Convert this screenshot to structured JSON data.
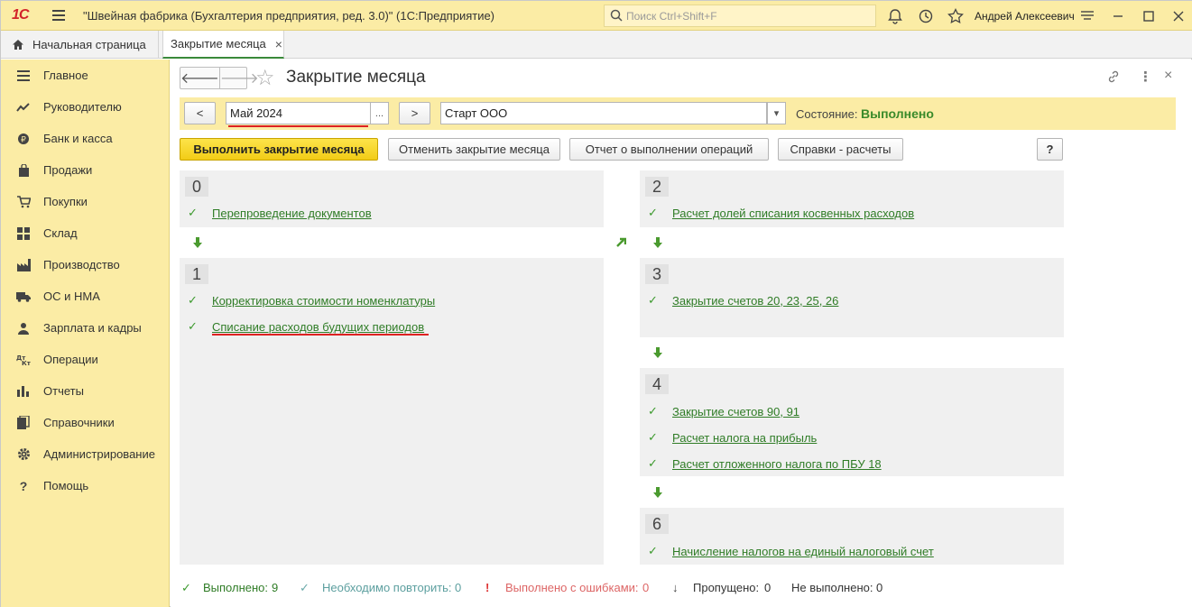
{
  "titlebar": {
    "logo": "1С",
    "title": "\"Швейная фабрика (Бухгалтерия предприятия, ред. 3.0)\"  (1С:Предприятие)",
    "search_placeholder": "Поиск Ctrl+Shift+F",
    "user": "Андрей Алексеевич"
  },
  "tabs": {
    "home": "Начальная страница",
    "active": "Закрытие месяца",
    "close": "×"
  },
  "sidebar": {
    "items": [
      {
        "label": "Главное",
        "icon": "menu-icon"
      },
      {
        "label": "Руководителю",
        "icon": "trend-icon"
      },
      {
        "label": "Банк и касса",
        "icon": "coin-icon"
      },
      {
        "label": "Продажи",
        "icon": "bag-icon"
      },
      {
        "label": "Покупки",
        "icon": "cart-icon"
      },
      {
        "label": "Склад",
        "icon": "warehouse-icon"
      },
      {
        "label": "Производство",
        "icon": "factory-icon"
      },
      {
        "label": "ОС и НМА",
        "icon": "truck-icon"
      },
      {
        "label": "Зарплата и кадры",
        "icon": "people-icon"
      },
      {
        "label": "Операции",
        "icon": "dt-kt-icon"
      },
      {
        "label": "Отчеты",
        "icon": "bar-chart-icon"
      },
      {
        "label": "Справочники",
        "icon": "books-icon"
      },
      {
        "label": "Администрирование",
        "icon": "gear-icon"
      },
      {
        "label": "Помощь",
        "icon": "help-icon"
      }
    ]
  },
  "form": {
    "title": "Закрытие месяца",
    "prev_btn": "<",
    "next_btn": ">",
    "period_value": "Май 2024",
    "period_select": "...",
    "org_value": "Старт ООО",
    "state_label": "Состояние:",
    "state_value": "Выполнено",
    "accent_color": "#3a8a2a"
  },
  "actions": {
    "run": "Выполнить закрытие месяца",
    "cancel": "Отменить закрытие месяца",
    "report": "Отчет о выполнении операций",
    "refs": "Справки - расчеты",
    "help": "?"
  },
  "stages": {
    "s0": {
      "num": "0",
      "ops": [
        "Перепроведение документов"
      ]
    },
    "s1": {
      "num": "1",
      "ops": [
        "Корректировка стоимости номенклатуры",
        "Списание расходов будущих периодов"
      ]
    },
    "s2": {
      "num": "2",
      "ops": [
        "Расчет долей списания косвенных расходов"
      ]
    },
    "s3": {
      "num": "3",
      "ops": [
        "Закрытие счетов 20, 23, 25, 26"
      ]
    },
    "s4": {
      "num": "4",
      "ops": [
        "Закрытие счетов 90, 91",
        "Расчет налога на прибыль",
        "Расчет отложенного налога по ПБУ 18"
      ]
    },
    "s6": {
      "num": "6",
      "ops": [
        "Начисление налогов на единый налоговый счет"
      ]
    }
  },
  "footer": {
    "done_label": "Выполнено:",
    "done_count": "9",
    "repeat_label": "Необходимо повторить:",
    "repeat_count": "0",
    "errors_label": "Выполнено с ошибками:",
    "errors_count": "0",
    "skipped_label": "Пропущено:",
    "skipped_count": "0",
    "notdone_label": "Не выполнено:",
    "notdone_count": "0"
  }
}
